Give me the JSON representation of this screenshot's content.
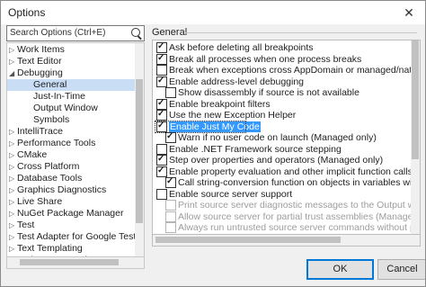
{
  "window": {
    "title": "Options",
    "close_glyph": "✕"
  },
  "search": {
    "text": "Search Options (Ctrl+E)"
  },
  "tree": {
    "items": [
      {
        "label": "Work Items",
        "arrow": "▷",
        "indent": 0
      },
      {
        "label": "Text Editor",
        "arrow": "▷",
        "indent": 0
      },
      {
        "label": "Debugging",
        "arrow": "◢",
        "indent": 0
      },
      {
        "label": "General",
        "arrow": "",
        "indent": 1,
        "selected": true
      },
      {
        "label": "Just-In-Time",
        "arrow": "",
        "indent": 1
      },
      {
        "label": "Output Window",
        "arrow": "",
        "indent": 1
      },
      {
        "label": "Symbols",
        "arrow": "",
        "indent": 1
      },
      {
        "label": "IntelliTrace",
        "arrow": "▷",
        "indent": 0
      },
      {
        "label": "Performance Tools",
        "arrow": "▷",
        "indent": 0
      },
      {
        "label": "CMake",
        "arrow": "▷",
        "indent": 0
      },
      {
        "label": "Cross Platform",
        "arrow": "▷",
        "indent": 0
      },
      {
        "label": "Database Tools",
        "arrow": "▷",
        "indent": 0
      },
      {
        "label": "Graphics Diagnostics",
        "arrow": "▷",
        "indent": 0
      },
      {
        "label": "Live Share",
        "arrow": "▷",
        "indent": 0
      },
      {
        "label": "NuGet Package Manager",
        "arrow": "▷",
        "indent": 0
      },
      {
        "label": "Test",
        "arrow": "▷",
        "indent": 0
      },
      {
        "label": "Test Adapter for Google Test",
        "arrow": "▷",
        "indent": 0
      },
      {
        "label": "Text Templating",
        "arrow": "▷",
        "indent": 0
      },
      {
        "label": "Web Forms Designer",
        "arrow": "▷",
        "indent": 0
      }
    ]
  },
  "section": {
    "title": "General"
  },
  "options": [
    {
      "label": "Ask before deleting all breakpoints",
      "checked": true,
      "indent": 0
    },
    {
      "label": "Break all processes when one process breaks",
      "checked": true,
      "indent": 0
    },
    {
      "label": "Break when exceptions cross AppDomain or managed/native boundaries",
      "checked": false,
      "indent": 0
    },
    {
      "label": "Enable address-level debugging",
      "checked": true,
      "indent": 0
    },
    {
      "label": "Show disassembly if source is not available",
      "checked": false,
      "indent": 1
    },
    {
      "label": "Enable breakpoint filters",
      "checked": true,
      "indent": 0
    },
    {
      "label": "Use the new Exception Helper",
      "checked": true,
      "indent": 0
    },
    {
      "label": "Enable Just My Code",
      "checked": true,
      "indent": 0,
      "highlighted": true
    },
    {
      "label": "Warn if no user code on launch (Managed only)",
      "checked": true,
      "indent": 1
    },
    {
      "label": "Enable .NET Framework source stepping",
      "checked": false,
      "indent": 0
    },
    {
      "label": "Step over properties and operators (Managed only)",
      "checked": true,
      "indent": 0
    },
    {
      "label": "Enable property evaluation and other implicit function calls",
      "checked": true,
      "indent": 0
    },
    {
      "label": "Call string-conversion function on objects in variables windows",
      "checked": true,
      "indent": 1
    },
    {
      "label": "Enable source server support",
      "checked": false,
      "indent": 0
    },
    {
      "label": "Print source server diagnostic messages to the Output window",
      "checked": false,
      "indent": 1,
      "disabled": true
    },
    {
      "label": "Allow source server for partial trust assemblies (Managed only)",
      "checked": false,
      "indent": 1,
      "disabled": true
    },
    {
      "label": "Always run untrusted source server commands without prompting",
      "checked": false,
      "indent": 1,
      "disabled": true
    }
  ],
  "buttons": {
    "ok": "OK",
    "cancel": "Cancel"
  }
}
